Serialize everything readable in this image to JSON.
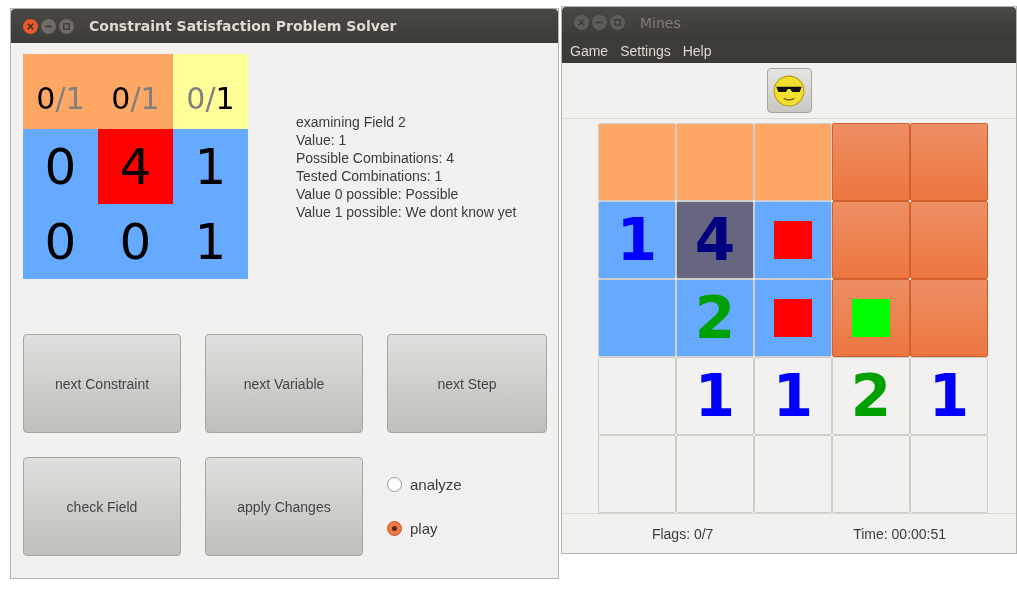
{
  "solver_window": {
    "title": "Constraint Satisfaction Problem Solver",
    "grid": [
      [
        {
          "color": "#ffa866",
          "parts": [
            {
              "text": "0",
              "dim": false
            },
            {
              "text": "/",
              "dim": true
            },
            {
              "text": "1",
              "dim": true
            }
          ]
        },
        {
          "color": "#ffa866",
          "parts": [
            {
              "text": "0",
              "dim": false
            },
            {
              "text": "/",
              "dim": true
            },
            {
              "text": "1",
              "dim": true
            }
          ]
        },
        {
          "color": "#ffff99",
          "parts": [
            {
              "text": "0",
              "dim": true
            },
            {
              "text": "/",
              "dim": true
            },
            {
              "text": "1",
              "dim": false
            }
          ]
        }
      ],
      [
        {
          "color": "#66aaff",
          "text": "0"
        },
        {
          "color": "#ff0000",
          "text": "4"
        },
        {
          "color": "#66aaff",
          "text": "1"
        }
      ],
      [
        {
          "color": "#66aaff",
          "text": "0"
        },
        {
          "color": "#66aaff",
          "text": "0"
        },
        {
          "color": "#66aaff",
          "text": "1"
        }
      ]
    ],
    "info_lines": [
      "examining Field 2",
      "Value: 1",
      "Possible Combinations: 4",
      "Tested Combinations: 1",
      "Value 0 possible: Possible",
      "Value 1 possible: We dont know yet"
    ],
    "buttons": [
      "next Constraint",
      "next Variable",
      "next Step",
      "check Field",
      "apply Changes"
    ],
    "modes": [
      {
        "label": "analyze",
        "selected": false
      },
      {
        "label": "play",
        "selected": true
      }
    ]
  },
  "mines_window": {
    "title": "Mines",
    "menu": [
      "Game",
      "Settings",
      "Help"
    ],
    "board": [
      [
        {
          "kind": "open",
          "color": "#ffa866"
        },
        {
          "kind": "open",
          "color": "#ffa866"
        },
        {
          "kind": "open",
          "color": "#ffa866"
        },
        {
          "kind": "covered",
          "color": "#ec7640"
        },
        {
          "kind": "covered",
          "color": "#ec7640"
        }
      ],
      [
        {
          "kind": "open",
          "color": "#66aaff",
          "number": {
            "text": "1",
            "color": "#0000ff"
          }
        },
        {
          "kind": "open",
          "color": "#666680",
          "number": {
            "text": "4",
            "color": "#000080"
          }
        },
        {
          "kind": "open",
          "color": "#66aaff",
          "marker": {
            "color": "#ff0000"
          }
        },
        {
          "kind": "covered",
          "color": "#ec7640"
        },
        {
          "kind": "covered",
          "color": "#ec7640"
        }
      ],
      [
        {
          "kind": "open",
          "color": "#66aaff"
        },
        {
          "kind": "open",
          "color": "#66aaff",
          "number": {
            "text": "2",
            "color": "#00a000"
          }
        },
        {
          "kind": "open",
          "color": "#66aaff",
          "marker": {
            "color": "#ff0000"
          }
        },
        {
          "kind": "covered",
          "color": "#ec7640",
          "marker": {
            "color": "#00ff00"
          }
        },
        {
          "kind": "covered",
          "color": "#ec7640"
        }
      ],
      [
        {
          "kind": "open",
          "color": "#f2f1f0"
        },
        {
          "kind": "open",
          "color": "#f2f1f0",
          "number": {
            "text": "1",
            "color": "#0000ff"
          }
        },
        {
          "kind": "open",
          "color": "#f2f1f0",
          "number": {
            "text": "1",
            "color": "#0000ff"
          }
        },
        {
          "kind": "open",
          "color": "#f2f1f0",
          "number": {
            "text": "2",
            "color": "#00a000"
          }
        },
        {
          "kind": "open",
          "color": "#f2f1f0",
          "number": {
            "text": "1",
            "color": "#0000ff"
          }
        }
      ],
      [
        {
          "kind": "open",
          "color": "#f2f1f0"
        },
        {
          "kind": "open",
          "color": "#f2f1f0"
        },
        {
          "kind": "open",
          "color": "#f2f1f0"
        },
        {
          "kind": "open",
          "color": "#f2f1f0"
        },
        {
          "kind": "open",
          "color": "#f2f1f0"
        }
      ]
    ],
    "flags": "Flags: 0/7",
    "time": "Time: 00:00:51"
  }
}
